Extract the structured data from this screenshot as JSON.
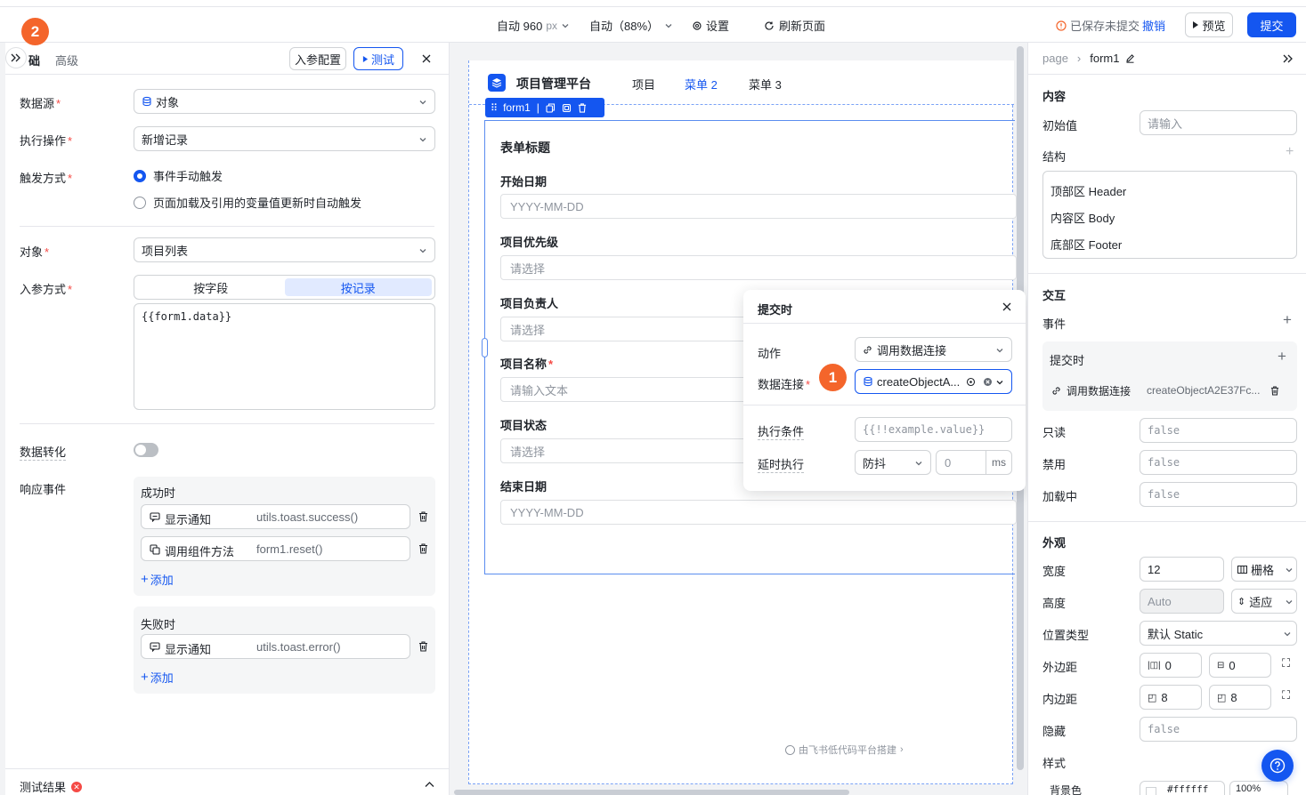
{
  "topbar": {
    "width_mode": "自动 960",
    "width_unit": "px",
    "zoom": "自动（88%）",
    "settings": "设置",
    "refresh": "刷新页面",
    "unsaved": "已保存未提交",
    "undo": "撤销",
    "preview": "预览",
    "submit": "提交"
  },
  "badges": {
    "first": "1",
    "second": "2"
  },
  "left": {
    "tab_basic": "基础",
    "tab_basic_visible": "础",
    "tab_advanced": "高级",
    "param_config": "入参配置",
    "test": "测试",
    "datasource_label": "数据源",
    "datasource_value": "对象",
    "operation_label": "执行操作",
    "operation_value": "新增记录",
    "trigger_label": "触发方式",
    "trigger_manual": "事件手动触发",
    "trigger_auto": "页面加载及引用的变量值更新时自动触发",
    "object_label": "对象",
    "object_value": "项目列表",
    "param_label": "入参方式",
    "seg_by_field": "按字段",
    "seg_by_record": "按记录",
    "param_code": "{{form1.data}}",
    "transform_label": "数据转化",
    "response_label": "响应事件",
    "success_title": "成功时",
    "success_events": [
      {
        "type": "显示通知",
        "value": "utils.toast.success()"
      },
      {
        "type": "调用组件方法",
        "value": "form1.reset()"
      }
    ],
    "add": "添加",
    "fail_title": "失败时",
    "fail_events": [
      {
        "type": "显示通知",
        "value": "utils.toast.error()"
      }
    ],
    "test_result": "测试结果"
  },
  "canvas": {
    "app_title": "项目管理平台",
    "nav": [
      "项目",
      "菜单 2",
      "菜单 3"
    ],
    "form_tag": "form1",
    "form_title": "表单标题",
    "fields": [
      {
        "label": "开始日期",
        "placeholder": "YYYY-MM-DD",
        "required": false
      },
      {
        "label": "项目优先级",
        "placeholder": "请选择",
        "required": false
      },
      {
        "label": "项目负责人",
        "placeholder": "请选择",
        "required": false
      },
      {
        "label": "项目名称",
        "placeholder": "请输入文本",
        "required": true
      },
      {
        "label": "项目状态",
        "placeholder": "请选择",
        "required": false
      },
      {
        "label": "结束日期",
        "placeholder": "YYYY-MM-DD",
        "required": false
      }
    ],
    "footer": "由飞书低代码平台搭建"
  },
  "popup": {
    "title": "提交时",
    "action_label": "动作",
    "action_value": "调用数据连接",
    "conn_label": "数据连接",
    "conn_value": "createObjectA...",
    "cond_label": "执行条件",
    "cond_placeholder": "{{!!example.value}}",
    "delay_label": "延时执行",
    "delay_mode": "防抖",
    "delay_placeholder": "0",
    "delay_unit": "ms"
  },
  "right": {
    "breadcrumb_root": "page",
    "breadcrumb_current": "form1",
    "content_title": "内容",
    "initial_label": "初始值",
    "initial_placeholder": "请输入",
    "structure_label": "结构",
    "structure_items": [
      "顶部区 Header",
      "内容区 Body",
      "底部区 Footer"
    ],
    "interact_title": "交互",
    "event_label": "事件",
    "event_name": "提交时",
    "event_action": "调用数据连接",
    "event_target": "createObjectA2E37Fc...",
    "readonly_label": "只读",
    "readonly_value": "false",
    "disabled_label": "禁用",
    "disabled_value": "false",
    "loading_label": "加载中",
    "loading_value": "false",
    "appearance_title": "外观",
    "width_label": "宽度",
    "width_value": "12",
    "width_mode": "栅格",
    "height_label": "高度",
    "height_value": "Auto",
    "height_mode": "适应",
    "position_label": "位置类型",
    "position_value": "默认 Static",
    "margin_label": "外边距",
    "margin_h": "0",
    "margin_v": "0",
    "padding_label": "内边距",
    "padding_h": "8",
    "padding_v": "8",
    "hidden_label": "隐藏",
    "hidden_value": "false",
    "style_label": "样式",
    "bg_label": "背景色",
    "bg_value": "#ffffff",
    "bg_opacity": "100%"
  },
  "colors": {
    "accent": "#1456f0",
    "badge": "#f4652b",
    "danger": "#f54a45"
  }
}
